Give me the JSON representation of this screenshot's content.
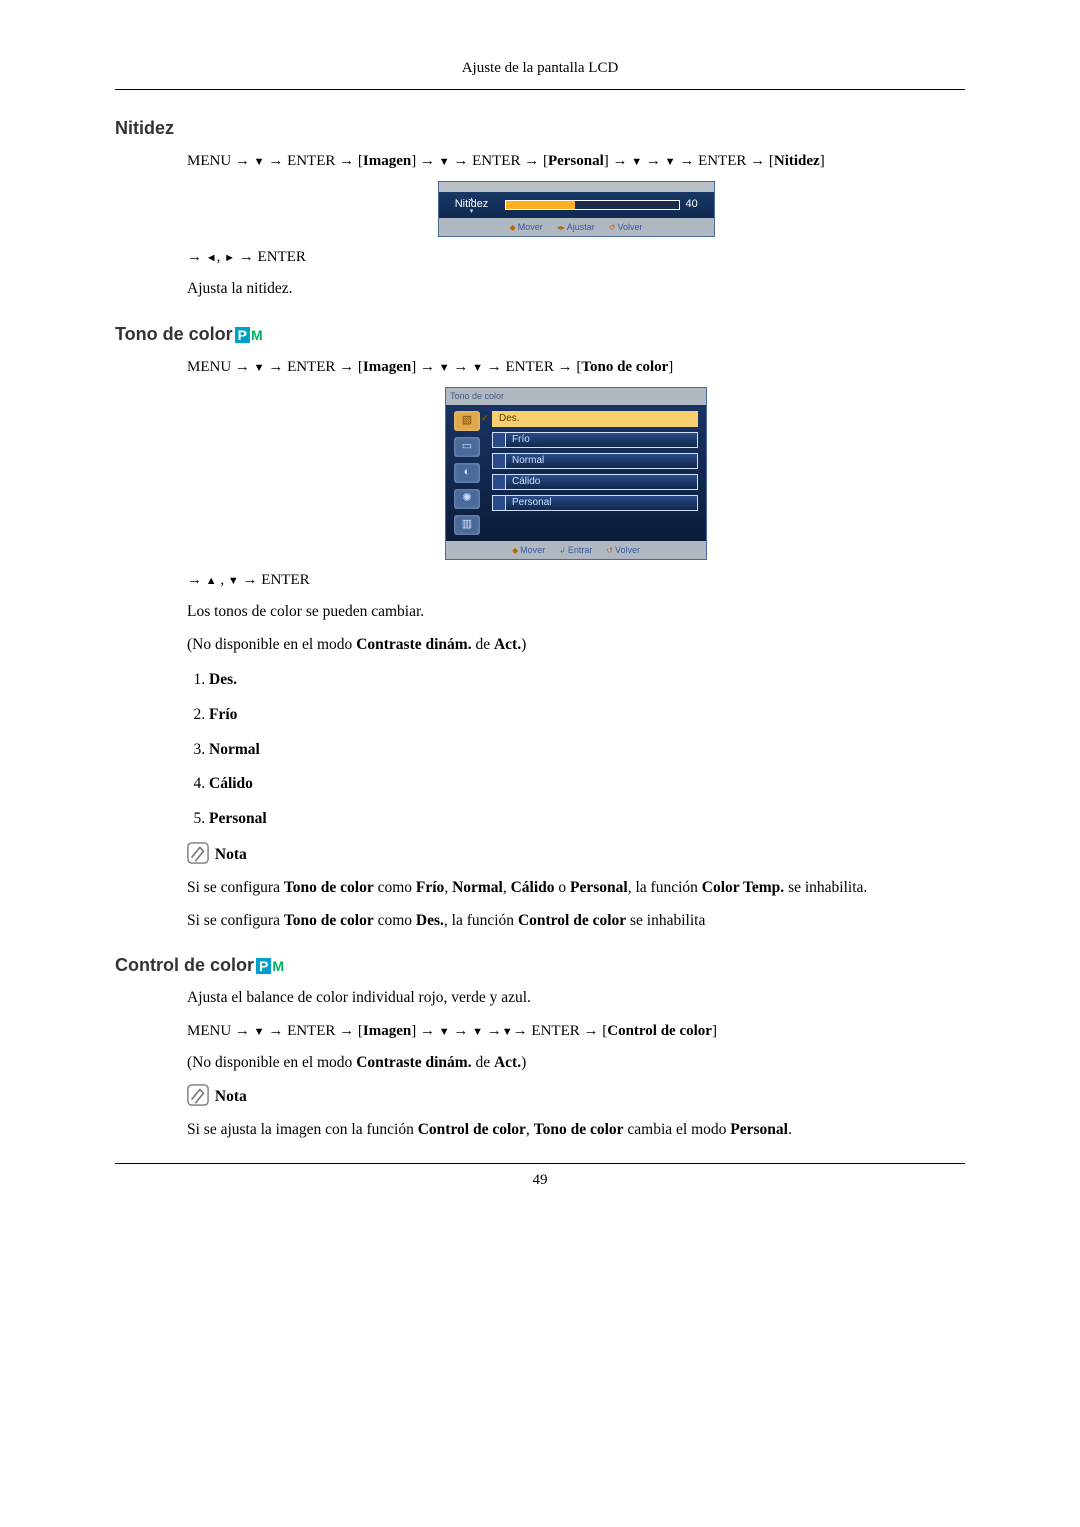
{
  "header": "Ajuste de la pantalla LCD",
  "page_number": "49",
  "glyphs": {
    "arrow": "→",
    "down": "▼",
    "up": "▲",
    "left": "◄",
    "right": "►"
  },
  "nitidez": {
    "heading": "Nitidez",
    "path": "MENU → ▼ → ENTER → [Imagen] → ▼ → ENTER → [Personal] → ▼ → ▼ → ENTER → [Nitidez]",
    "osd": {
      "label": "Nitidez",
      "value": "40",
      "nav": {
        "mover": "Mover",
        "ajustar": "Ajustar",
        "volver": "Volver"
      }
    },
    "after_osd": "→ ◄, ► → ENTER",
    "desc": "Ajusta la nitidez."
  },
  "tono": {
    "heading": "Tono de color",
    "path": "MENU → ▼ → ENTER → [Imagen] → ▼ → ▼ → ENTER → [Tono de color]",
    "osd": {
      "title": "Tono de color",
      "options": [
        "Des.",
        "Frío",
        "Normal",
        "Cálido",
        "Personal"
      ],
      "nav": {
        "mover": "Mover",
        "entrar": "Entrar",
        "volver": "Volver"
      }
    },
    "after_osd": "→ ▲ , ▼ → ENTER",
    "desc1": "Los tonos de color se pueden cambiar.",
    "desc2_pre": "(No disponible en el modo ",
    "desc2_b1": "Contraste dinám.",
    "desc2_mid": " de ",
    "desc2_b2": "Act.",
    "desc2_post": ")",
    "list": [
      "Des.",
      "Frío",
      "Normal",
      "Cálido",
      "Personal"
    ],
    "nota_label": "Nota",
    "nota1": {
      "pre": "Si se configura ",
      "b1": "Tono de color",
      "mid1": " como ",
      "b2": "Frío",
      "sep1": ", ",
      "b3": "Normal",
      "sep2": ", ",
      "b4": "Cálido",
      "mid2": " o ",
      "b5": "Personal",
      "mid3": ", la función ",
      "b6": "Color Temp.",
      "post": " se inhabilita."
    },
    "nota2": {
      "pre": "Si se configura ",
      "b1": "Tono de color",
      "mid1": " como ",
      "b2": "Des.",
      "mid2": ", la función ",
      "b3": "Control de color",
      "post": " se inhabilita"
    }
  },
  "control": {
    "heading": "Control de color",
    "desc": "Ajusta el balance de color individual rojo, verde y azul.",
    "path": "MENU → ▼ → ENTER → [Imagen] → ▼ → ▼ →▼→ ENTER → [Control de color]",
    "desc2_pre": "(No disponible en el modo ",
    "desc2_b1": "Contraste dinám.",
    "desc2_mid": " de ",
    "desc2_b2": "Act.",
    "desc2_post": ")",
    "nota_label": "Nota",
    "nota1": {
      "pre": "Si se ajusta la imagen con la función ",
      "b1": "Control de color",
      "mid1": ", ",
      "b2": "Tono de color",
      "mid2": " cambia el modo ",
      "b3": "Personal",
      "post": "."
    }
  },
  "chart_data": {
    "type": "bar",
    "title": "Nitidez OSD slider",
    "categories": [
      "Nitidez"
    ],
    "values": [
      40
    ],
    "ylim": [
      0,
      100
    ]
  }
}
